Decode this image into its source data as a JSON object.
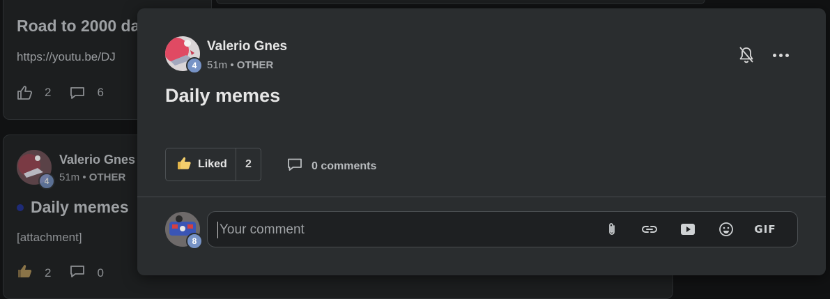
{
  "background_feed": {
    "top_post": {
      "title": "Road to 2000 da",
      "link": "https://youtu.be/DJ",
      "likes": "2",
      "comments": "6"
    },
    "second_post": {
      "author": "Valerio Gnes",
      "avatar_level": "4",
      "time": "51m",
      "category": "OTHER",
      "title": "Daily memes",
      "body": "[attachment]",
      "likes": "2",
      "comments": "0"
    }
  },
  "modal": {
    "author": "Valerio Gnes",
    "avatar_level": "4",
    "time": "51m",
    "separator": "•",
    "category": "OTHER",
    "title": "Daily memes",
    "like_label": "Liked",
    "like_count": "2",
    "comments_label": "0 comments",
    "icons": {
      "bell": "bell-off-icon",
      "more": "more-horizontal-icon",
      "like": "thumbs-up-emoji-icon",
      "comment": "comment-bubble-icon"
    }
  },
  "composer": {
    "user_level": "8",
    "placeholder": "Your comment",
    "value": "",
    "tools": {
      "attach": "paperclip-icon",
      "link": "link-icon",
      "video": "youtube-icon",
      "emoji": "emoji-icon",
      "gif": "GIF"
    }
  },
  "colors": {
    "modal_bg": "#2a2d2f",
    "page_bg": "#111213",
    "badge": "#7793c6",
    "accent_dot": "#1e2b77"
  }
}
